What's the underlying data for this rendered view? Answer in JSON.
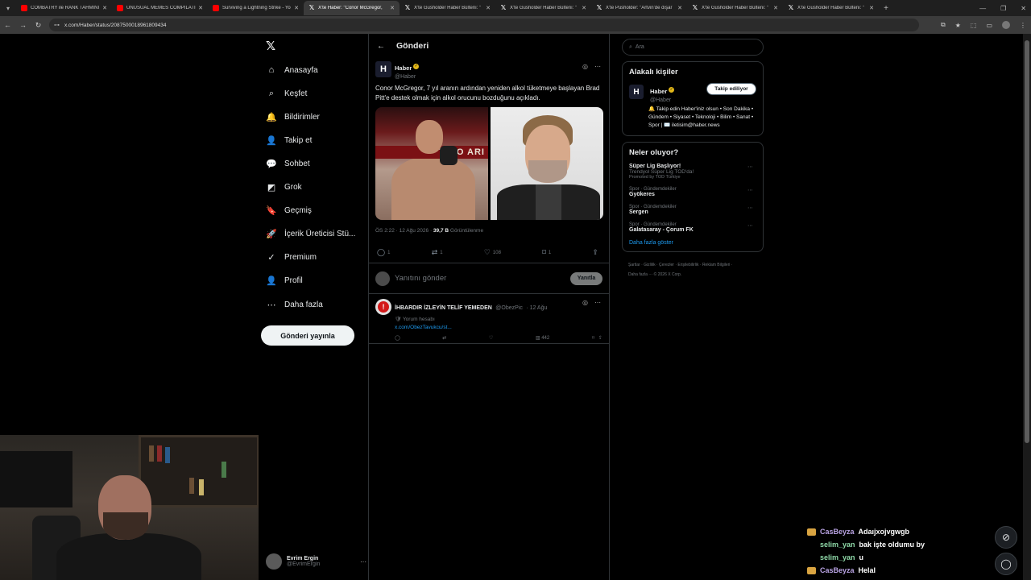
{
  "browser": {
    "tabs": [
      {
        "title": "COMBATRY ile RANK TAHMINI",
        "favicon": "yt"
      },
      {
        "title": "UNUSUAL MEMES COMPILATIO",
        "favicon": "yt"
      },
      {
        "title": "Surviving a Lightning Strike - Yo",
        "favicon": "yt"
      },
      {
        "title": "X'te Haber: \"Conor McGregor,",
        "favicon": "x"
      },
      {
        "title": "X'te Gusholder Haber Bülteni: \"",
        "favicon": "x"
      },
      {
        "title": "X'te Gusholder Haber Bülteni: \"",
        "favicon": "x"
      },
      {
        "title": "X'te Pusholder: \"Artvin'de dışar",
        "favicon": "x"
      },
      {
        "title": "X'te Gusholder Haber Bülteni: \"",
        "favicon": "x"
      },
      {
        "title": "X'te Gusholder Haber Bülteni: \"",
        "favicon": "x"
      }
    ],
    "active_tab": 3,
    "url": "x.com/Haber/status/2087500018961809434"
  },
  "nav": {
    "items": [
      {
        "label": "Anasayfa",
        "icon": "home-icon",
        "glyph": "⌂"
      },
      {
        "label": "Keşfet",
        "icon": "search-icon",
        "glyph": "⌕"
      },
      {
        "label": "Bildirimler",
        "icon": "bell-icon",
        "glyph": "🔔"
      },
      {
        "label": "Takip et",
        "icon": "follow-icon",
        "glyph": "👤"
      },
      {
        "label": "Sohbet",
        "icon": "chat-icon",
        "glyph": "💬"
      },
      {
        "label": "Grok",
        "icon": "grok-icon",
        "glyph": "◩"
      },
      {
        "label": "Geçmiş",
        "icon": "bookmark-icon",
        "glyph": "🔖"
      },
      {
        "label": "İçerik Üreticisi Stü...",
        "icon": "rocket-icon",
        "glyph": "🚀"
      },
      {
        "label": "Premium",
        "icon": "premium-icon",
        "glyph": "✓"
      },
      {
        "label": "Profil",
        "icon": "profile-icon",
        "glyph": "👤"
      },
      {
        "label": "Daha fazla",
        "icon": "more-icon",
        "glyph": "⋯"
      }
    ],
    "post_button": "Gönderi yayınla",
    "user_name": "Evrim Ergin",
    "user_handle": "@EvrimErgin"
  },
  "center": {
    "title": "Gönderi",
    "post": {
      "author": "Haber",
      "handle": "@Haber",
      "avatar_letter": "H",
      "text": "Conor McGregor, 7 yıl aranın ardından yeniden alkol tüketmeye başlayan Brad Pitt'e destek olmak için alkol orucunu bozduğunu açıkladı.",
      "image1_banner": "T-MO ARI",
      "time": "ÖS 2:22 · 12 Ağu 2026 ·",
      "views": "39,7 B",
      "views_label": "Görüntülenme",
      "replies": "1",
      "reposts": "1",
      "likes": "108",
      "bookmarks": "1"
    },
    "reply_placeholder": "Yanıtını gönder",
    "reply_button": "Yanıtla",
    "reply": {
      "name": "İHBARDIR İZLEYİN TELİF YEMEDEN",
      "handle": "@ObezPic",
      "time": "· 12 Ağu",
      "sub": "🛡 Yorum hesabı",
      "link": "x.com/ObezTavukcu/st...",
      "views": "442"
    }
  },
  "right": {
    "search_placeholder": "Ara",
    "related_title": "Alakalı kişiler",
    "related": {
      "name": "Haber",
      "handle": "@Haber",
      "follow_label": "Takip ediliyor",
      "bio": "🔔 Takip edin Haber'iniz olsun • Son Dakika • Gündem • Siyaset • Teknoloji • Bilim • Sanat • Spor | ✉️ iletisim@haber.news"
    },
    "trends_title": "Neler oluyor?",
    "trends": [
      {
        "label": "",
        "title": "Süper Lig Başlıyor!",
        "sub": "Trendyol Süper Lig TOD'da!",
        "promo": "Promoted by TOD Türkiye"
      },
      {
        "label": "Spor · Gündemdekiler",
        "title": "Gyökeres",
        "sub": "",
        "promo": ""
      },
      {
        "label": "Spor · Gündemdekiler",
        "title": "Sergen",
        "sub": "",
        "promo": ""
      },
      {
        "label": "Spor · Gündemdekiler",
        "title": "Galatasaray - Çorum FK",
        "sub": "",
        "promo": ""
      }
    ],
    "show_more": "Daha fazla göster",
    "footer": "Şartlar · Gizlilik · Çerezler · Erişilebilirlik · Reklam Bilgileri · Daha fazla ··· © 2026 X Corp."
  },
  "chat": [
    {
      "user": "CasBeyza",
      "color": "#b9a3e3",
      "badge": true,
      "msg": "Adaıjxojvgwgb"
    },
    {
      "user": "selim_yan",
      "color": "#8fd9a8",
      "badge": false,
      "msg": "bak işte oldumu by"
    },
    {
      "user": "selim_yan",
      "color": "#8fd9a8",
      "badge": false,
      "msg": "u"
    },
    {
      "user": "CasBeyza",
      "color": "#b9a3e3",
      "badge": true,
      "msg": "Helal"
    }
  ]
}
